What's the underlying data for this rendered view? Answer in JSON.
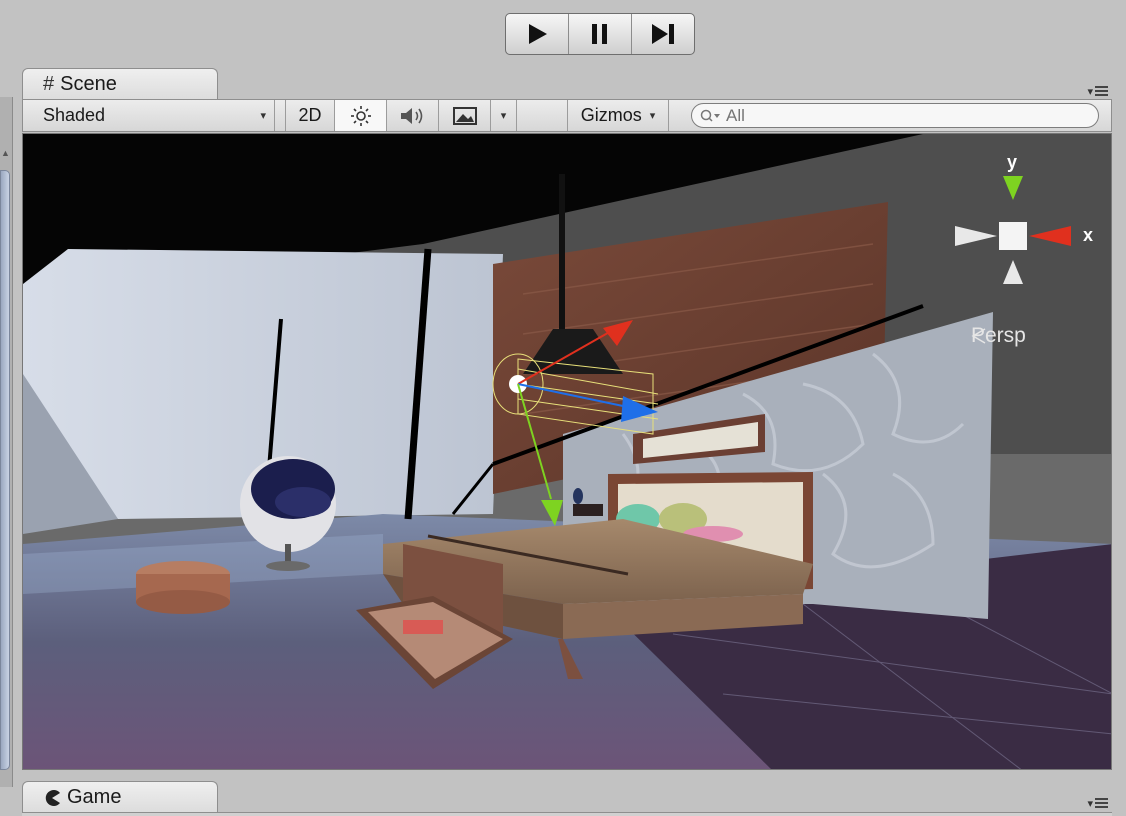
{
  "playbar": {
    "play_icon": "play-icon",
    "pause_icon": "pause-icon",
    "step_icon": "step-icon"
  },
  "scene_tab": {
    "label": "Scene",
    "icon": "grid-hash-icon"
  },
  "game_tab": {
    "label": "Game",
    "icon": "pacman-icon"
  },
  "toolbar": {
    "shading_mode": "Shaded",
    "two_d_label": "2D",
    "gizmos_label": "Gizmos",
    "search_placeholder": "All"
  },
  "viewport": {
    "projection_label": "Persp",
    "axis_y": "y",
    "axis_x": "x"
  },
  "colors": {
    "axis_x": "#e0301e",
    "axis_y": "#7ed321",
    "axis_z": "#1f6fe8"
  }
}
